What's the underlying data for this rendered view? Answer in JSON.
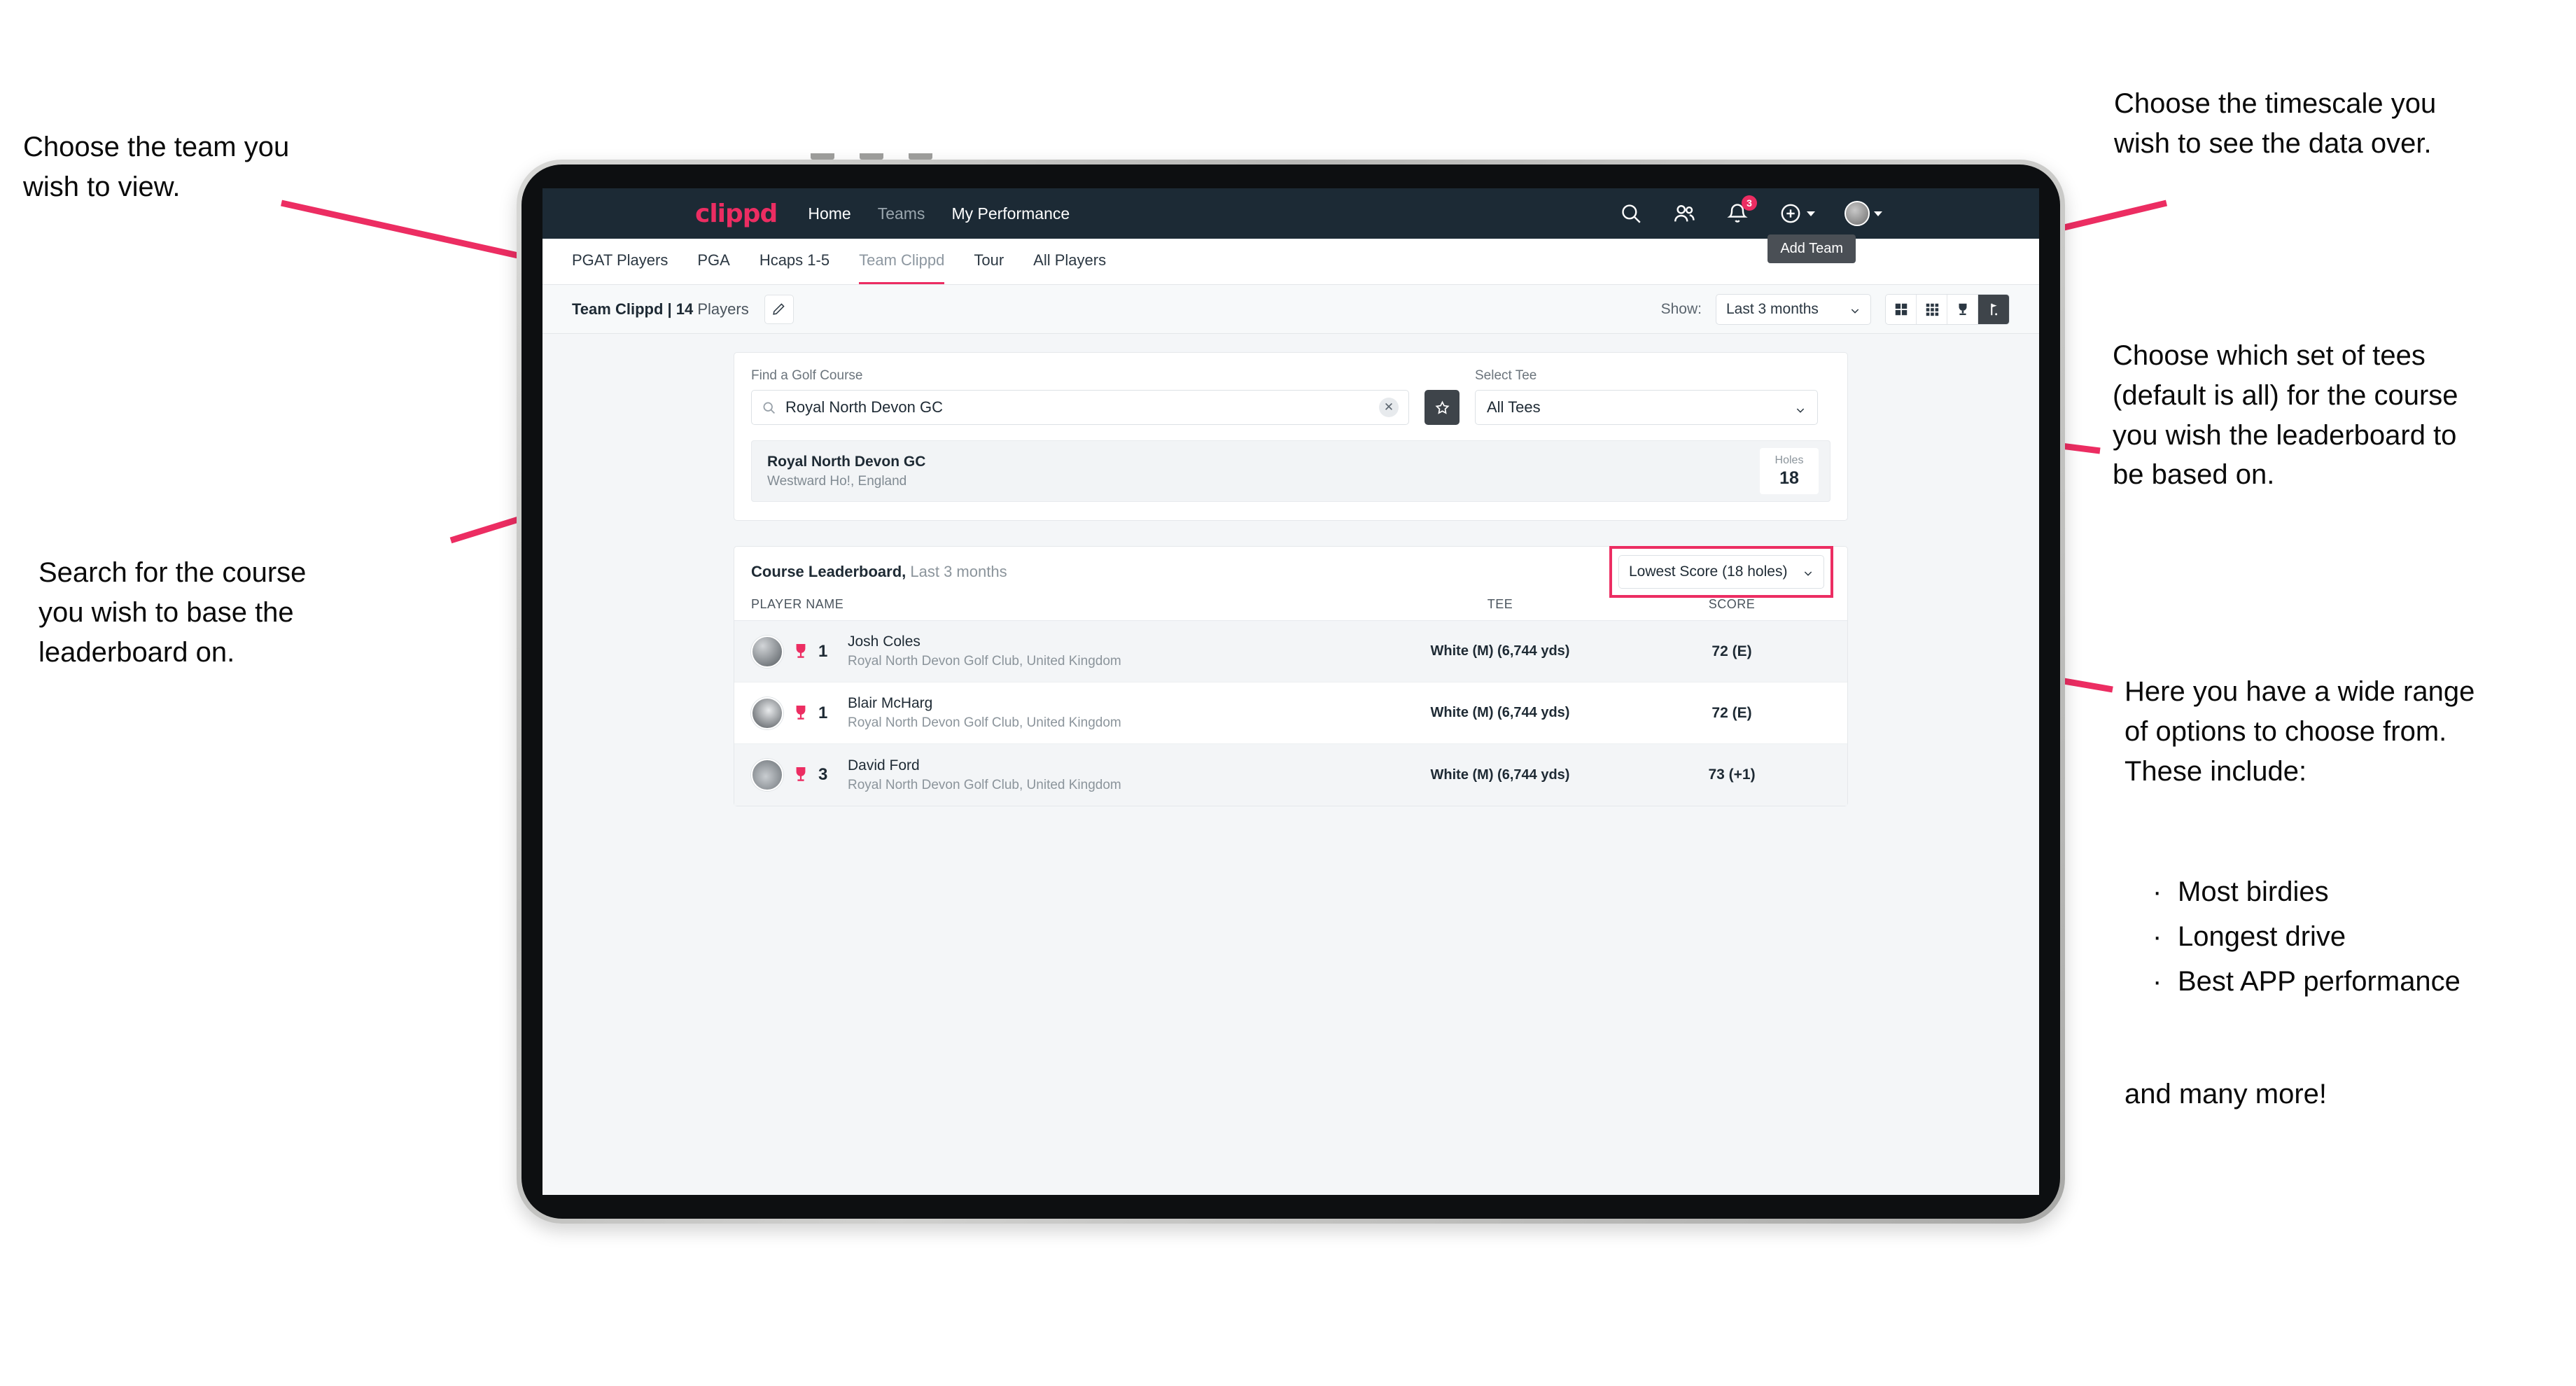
{
  "annotations": {
    "team": "Choose the team you\nwish to view.",
    "timescale": "Choose the timescale you\nwish to see the data over.",
    "tees": "Choose which set of tees\n(default is all) for the course\nyou wish the leaderboard to\nbe based on.",
    "search": "Search for the course\nyou wish to base the\nleaderboard on.",
    "options_intro": "Here you have a wide range\nof options to choose from.\nThese include:",
    "options_list": [
      "Most birdies",
      "Longest drive",
      "Best APP performance"
    ],
    "options_outro": "and many more!"
  },
  "app": {
    "brand": "clippd",
    "nav": [
      {
        "label": "Home",
        "muted": false
      },
      {
        "label": "Teams",
        "muted": true
      },
      {
        "label": "My Performance",
        "muted": false
      }
    ],
    "icons": {
      "search": "search-icon",
      "people": "people-icon",
      "bell": "bell-icon",
      "bell_badge": "3",
      "plus": "plus-circle-icon",
      "avatar": "user-avatar"
    },
    "tabs": [
      {
        "label": "PGAT Players",
        "state": "normal"
      },
      {
        "label": "PGA",
        "state": "normal"
      },
      {
        "label": "Hcaps 1-5",
        "state": "normal"
      },
      {
        "label": "Team Clippd",
        "state": "active"
      },
      {
        "label": "Tour",
        "state": "normal"
      },
      {
        "label": "All Players",
        "state": "normal"
      }
    ],
    "tooltip": "Add Team"
  },
  "toolbar": {
    "team_name": "Team Clippd | 14",
    "team_suffix": " Players",
    "edit_icon": "pencil-icon",
    "show_label": "Show:",
    "show_value": "Last 3 months",
    "views": [
      {
        "name": "grid-4-view",
        "active": false
      },
      {
        "name": "grid-9-view",
        "active": false
      },
      {
        "name": "trophy-view",
        "active": false
      },
      {
        "name": "golf-flag-view",
        "active": true
      }
    ]
  },
  "search": {
    "course_label": "Find a Golf Course",
    "course_value": "Royal North Devon GC",
    "course_placeholder": "Find a Golf Course",
    "clear_icon": "close-icon",
    "favourite_icon": "star-icon",
    "tee_label": "Select Tee",
    "tee_value": "All Tees"
  },
  "course": {
    "name": "Royal North Devon GC",
    "location": "Westward Ho!, England",
    "holes_label": "Holes",
    "holes_value": "18"
  },
  "leaderboard": {
    "title": "Course Leaderboard,",
    "subtitle": " Last 3 months",
    "metric": "Lowest Score (18 holes)",
    "columns": [
      "PLAYER NAME",
      "TEE",
      "SCORE"
    ],
    "rows": [
      {
        "rank": "1",
        "name": "Josh Coles",
        "club": "Royal North Devon Golf Club, United Kingdom",
        "tee": "White (M) (6,744 yds)",
        "score": "72 (E)"
      },
      {
        "rank": "1",
        "name": "Blair McHarg",
        "club": "Royal North Devon Golf Club, United Kingdom",
        "tee": "White (M) (6,744 yds)",
        "score": "72 (E)"
      },
      {
        "rank": "3",
        "name": "David Ford",
        "club": "Royal North Devon Golf Club, United Kingdom",
        "tee": "White (M) (6,744 yds)",
        "score": "73 (+1)"
      }
    ]
  },
  "colors": {
    "accent": "#ec2d62",
    "topbar": "#1c2a35",
    "screen_bg": "#f4f6f8"
  }
}
